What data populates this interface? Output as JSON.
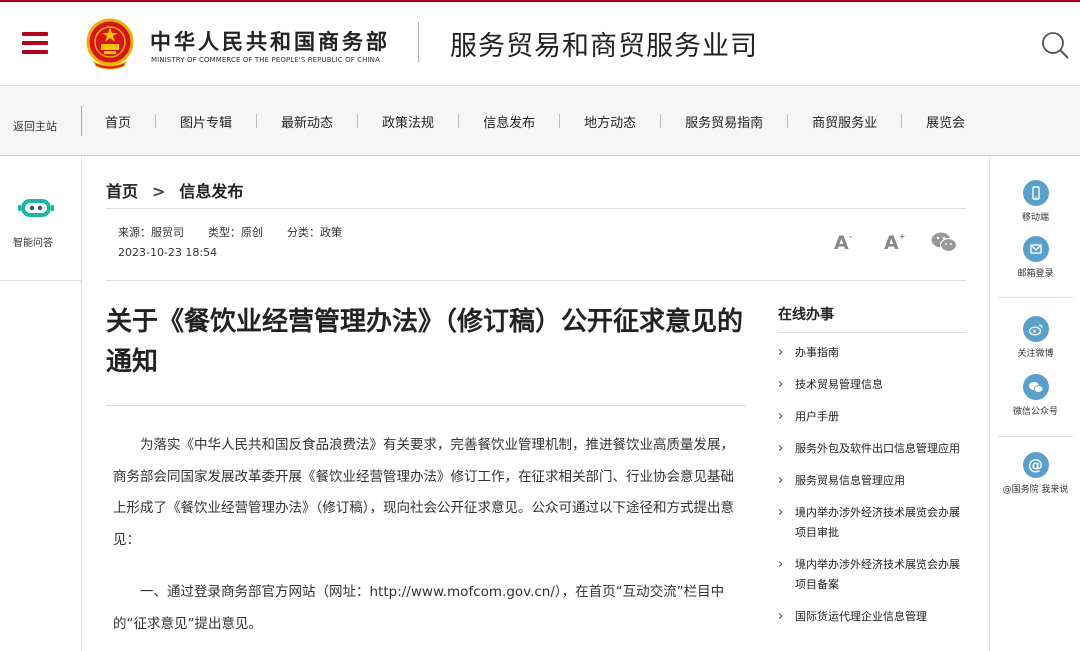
{
  "header": {
    "org_name": "中华人民共和国商务部",
    "org_name_en": "MINISTRY OF COMMERCE OF THE PEOPLE'S REPUBLIC OF CHINA",
    "dept_name": "服务贸易和商贸服务业司",
    "accent_color": "#b3001b"
  },
  "nav": {
    "back_home": "返回主站",
    "items": [
      "首页",
      "图片专辑",
      "最新动态",
      "政策法规",
      "信息发布",
      "地方动态",
      "服务贸易指南",
      "商贸服务业",
      "展览会"
    ]
  },
  "left_rail": {
    "assistant_label": "智能问答"
  },
  "right_rail": {
    "items": [
      "移动端",
      "邮箱登录",
      "关注微博",
      "微信公众号",
      "@国务院 我来说"
    ],
    "icon_color": "#5aa0c8"
  },
  "breadcrumb": {
    "home": "首页",
    "separator": ">",
    "current": "信息发布"
  },
  "meta": {
    "source": "来源：服贸司",
    "type": "类型：原创",
    "category": "分类：政策",
    "datetime": "2023-10-23 18:54"
  },
  "toolbar": {
    "font_large": "A",
    "font_small": "A"
  },
  "article": {
    "title": "关于《餐饮业经营管理办法》（修订稿）公开征求意见的通知",
    "paragraphs": [
      "为落实《中华人民共和国反食品浪费法》有关要求，完善餐饮业管理机制，推进餐饮业高质量发展，商务部会同国家发展改革委开展《餐饮业经营管理办法》修订工作，在征求相关部门、行业协会意见基础上形成了《餐饮业经营管理办法》（修订稿），现向社会公开征求意见。公众可通过以下途径和方式提出意见：",
      "一、通过登录商务部官方网站（网址：http://www.mofcom.gov.cn/），在首页“互动交流”栏目中的“征求意见”提出意见。"
    ]
  },
  "services": {
    "title": "在线办事",
    "items": [
      "办事指南",
      "技术贸易管理信息",
      "用户手册",
      "服务外包及软件出口信息管理应用",
      "服务贸易信息管理应用",
      "境内举办涉外经济技术展览会办展项目审批",
      "境内举办涉外经济技术展览会办展项目备案",
      "国际货运代理企业信息管理"
    ]
  }
}
